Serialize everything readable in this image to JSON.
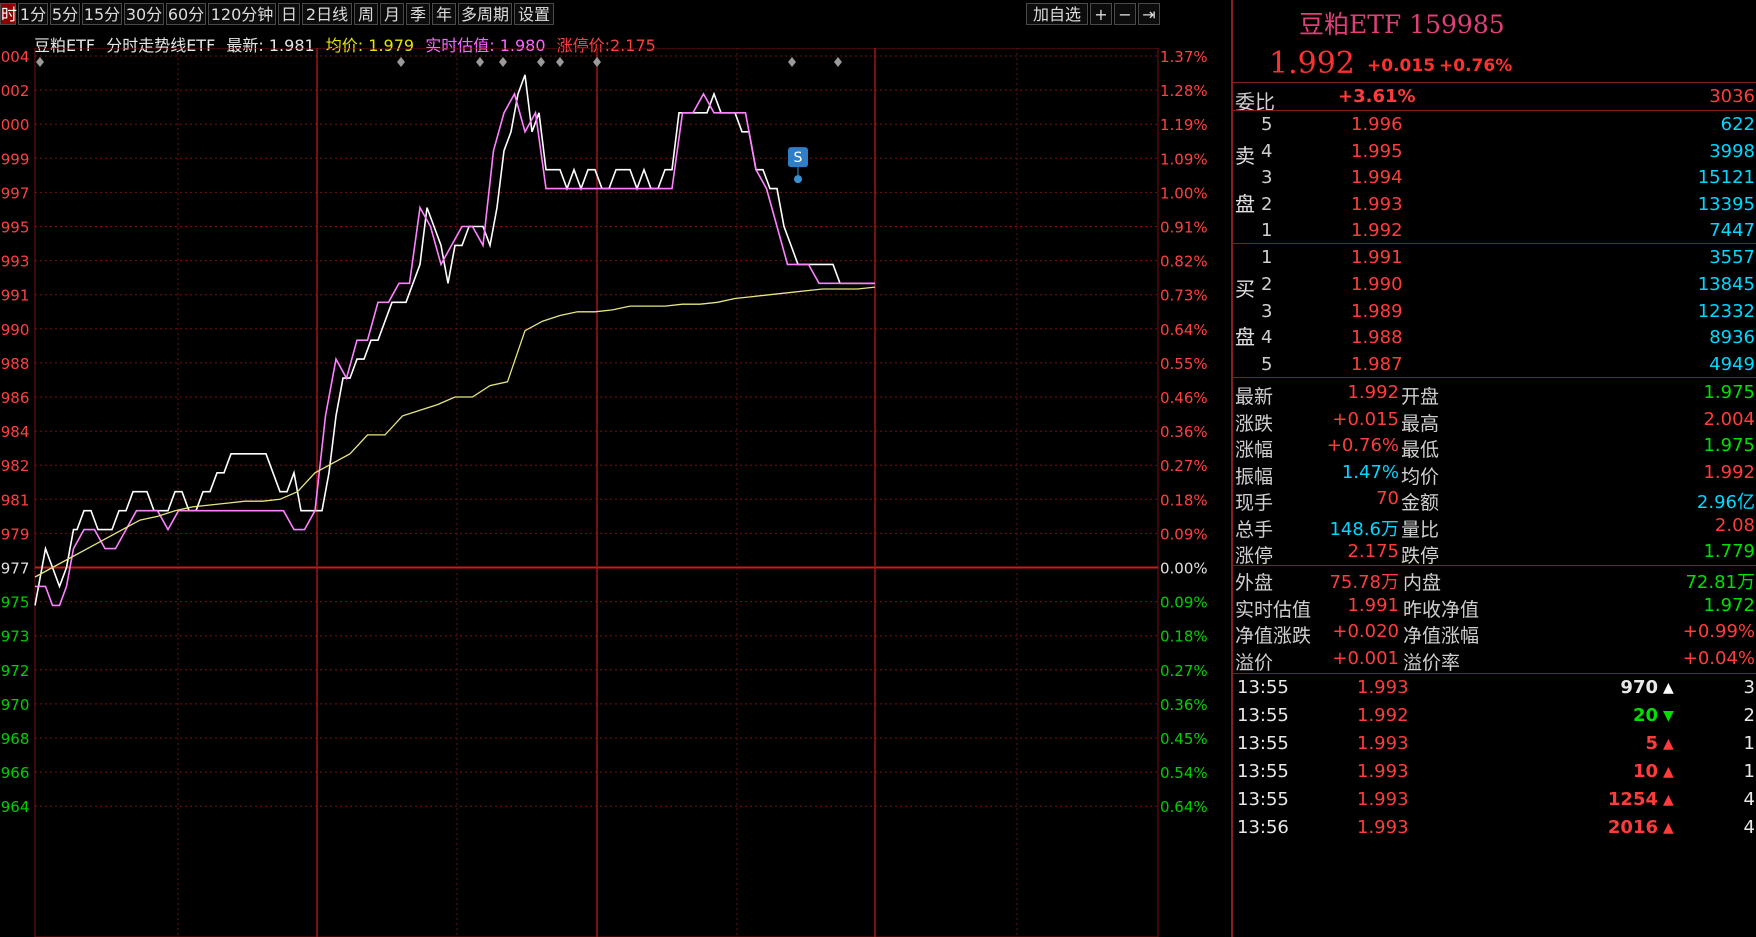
{
  "toolbar": {
    "items": [
      "时",
      "1分",
      "5分",
      "15分",
      "30分",
      "60分",
      "120分钟",
      "日",
      "2日线",
      "周",
      "月",
      "季",
      "年",
      "多周期",
      "设置"
    ],
    "right": {
      "add": "加自选",
      "plus": "+",
      "minus": "−",
      "exit": "⇥"
    }
  },
  "info": {
    "name": "豆粕ETF",
    "indicator": "分时走势线ETF",
    "latest_label": "最新:",
    "latest": "1.981",
    "avg_label": "均价:",
    "avg": "1.979",
    "est_label": "实时估值:",
    "est": "1.980",
    "limit_label": "涨停价:",
    "limit": "2.175"
  },
  "chart_data": {
    "type": "line",
    "title": "豆粕ETF 分时走势线ETF",
    "prev_close": 1.977,
    "y_ticks": [
      ".004",
      ".002",
      ".000",
      ".999",
      ".997",
      ".995",
      ".993",
      ".991",
      ".990",
      ".988",
      ".986",
      ".984",
      ".982",
      ".981",
      ".979",
      ".977",
      ".975",
      ".973",
      ".972",
      ".970",
      ".968",
      ".966",
      ".964"
    ],
    "pct_ticks": [
      "1.37%",
      "1.28%",
      "1.19%",
      "1.09%",
      "1.00%",
      "0.91%",
      "0.82%",
      "0.73%",
      "0.64%",
      "0.55%",
      "0.46%",
      "0.36%",
      "0.27%",
      "0.18%",
      "0.09%",
      "0.00%",
      "0.09%",
      "0.18%",
      "0.27%",
      "0.36%",
      "0.45%",
      "0.54%",
      "0.64%"
    ],
    "ylim": [
      1.9635,
      2.004
    ],
    "series": [
      {
        "name": "最新",
        "color": "#ffffff",
        "x": [
          0,
          3,
          5,
          7,
          9,
          11,
          12,
          14,
          16,
          18,
          20,
          22,
          24,
          26,
          28,
          30,
          32,
          34,
          36,
          38,
          40,
          42,
          44,
          46,
          48,
          50,
          52,
          54,
          56,
          58,
          60,
          62,
          64,
          66,
          68,
          70,
          72,
          74,
          76,
          78,
          80,
          82,
          84,
          86,
          88,
          90,
          92,
          94,
          96,
          98,
          100,
          102,
          104,
          106,
          108,
          110,
          112,
          114,
          116,
          118,
          120,
          122,
          124,
          126,
          128,
          130,
          132,
          134,
          136,
          138,
          140,
          142,
          144,
          146,
          148,
          150,
          152,
          154,
          156,
          158,
          160,
          162,
          164,
          166,
          168,
          170,
          172,
          174,
          176,
          178,
          180,
          182,
          184,
          186,
          188,
          190,
          192,
          194,
          196,
          198,
          200,
          202,
          204,
          206,
          208,
          210,
          212,
          214,
          216,
          218,
          220,
          222,
          224,
          226,
          228,
          230,
          232,
          234,
          236,
          238,
          240
        ],
        "y": [
          1.975,
          1.978,
          1.977,
          1.976,
          1.977,
          1.979,
          1.979,
          1.98,
          1.98,
          1.979,
          1.979,
          1.979,
          1.98,
          1.98,
          1.981,
          1.981,
          1.981,
          1.98,
          1.98,
          1.98,
          1.981,
          1.981,
          1.98,
          1.98,
          1.981,
          1.981,
          1.982,
          1.982,
          1.983,
          1.983,
          1.983,
          1.983,
          1.983,
          1.983,
          1.982,
          1.981,
          1.981,
          1.982,
          1.98,
          1.98,
          1.98,
          1.98,
          1.982,
          1.985,
          1.987,
          1.987,
          1.988,
          1.988,
          1.989,
          1.989,
          1.99,
          1.991,
          1.991,
          1.991,
          1.992,
          1.993,
          1.996,
          1.995,
          1.994,
          1.992,
          1.994,
          1.994,
          1.995,
          1.995,
          1.995,
          1.994,
          1.996,
          1.999,
          2.0,
          2.002,
          2.003,
          2.0,
          2.001,
          1.998,
          1.998,
          1.998,
          1.997,
          1.998,
          1.997,
          1.998,
          1.998,
          1.997,
          1.997,
          1.998,
          1.998,
          1.998,
          1.997,
          1.998,
          1.997,
          1.997,
          1.998,
          1.998,
          2.001,
          2.001,
          2.001,
          2.001,
          2.001,
          2.002,
          2.001,
          2.001,
          2.001,
          2.0,
          2.0,
          1.998,
          1.998,
          1.997,
          1.997,
          1.995,
          1.994,
          1.993,
          1.993,
          1.993,
          1.993,
          1.993,
          1.993,
          1.992,
          1.992,
          1.992,
          1.992,
          1.992,
          1.992
        ]
      },
      {
        "name": "实时估值",
        "color": "#ff80ff",
        "x": [
          0,
          3,
          5,
          7,
          9,
          11,
          14,
          17,
          20,
          23,
          26,
          29,
          32,
          35,
          38,
          41,
          44,
          47,
          50,
          53,
          56,
          59,
          62,
          65,
          68,
          71,
          74,
          77,
          80,
          83,
          86,
          89,
          92,
          95,
          98,
          101,
          104,
          107,
          110,
          113,
          116,
          119,
          122,
          125,
          128,
          131,
          134,
          137,
          140,
          143,
          146,
          149,
          152,
          155,
          158,
          161,
          164,
          167,
          170,
          173,
          176,
          179,
          182,
          185,
          188,
          191,
          194,
          197,
          200,
          203,
          206,
          209,
          212,
          215,
          218,
          221,
          224,
          227,
          230,
          233,
          236,
          239,
          240
        ],
        "y": [
          1.976,
          1.976,
          1.975,
          1.975,
          1.976,
          1.978,
          1.979,
          1.979,
          1.978,
          1.978,
          1.979,
          1.98,
          1.98,
          1.98,
          1.979,
          1.98,
          1.98,
          1.98,
          1.98,
          1.98,
          1.98,
          1.98,
          1.98,
          1.98,
          1.98,
          1.98,
          1.979,
          1.979,
          1.98,
          1.985,
          1.988,
          1.987,
          1.989,
          1.989,
          1.991,
          1.991,
          1.992,
          1.992,
          1.996,
          1.995,
          1.993,
          1.994,
          1.995,
          1.995,
          1.994,
          1.999,
          2.001,
          2.002,
          2.0,
          2.001,
          1.997,
          1.997,
          1.997,
          1.997,
          1.997,
          1.997,
          1.997,
          1.997,
          1.997,
          1.997,
          1.997,
          1.997,
          1.997,
          2.001,
          2.001,
          2.002,
          2.001,
          2.001,
          2.001,
          2.001,
          1.998,
          1.997,
          1.995,
          1.993,
          1.993,
          1.993,
          1.992,
          1.992,
          1.992,
          1.992,
          1.992,
          1.992,
          1.992
        ]
      },
      {
        "name": "均价",
        "color": "#e6e680",
        "x": [
          0,
          5,
          10,
          15,
          20,
          25,
          30,
          35,
          40,
          45,
          50,
          55,
          60,
          65,
          70,
          75,
          80,
          85,
          90,
          95,
          100,
          105,
          110,
          115,
          120,
          125,
          130,
          135,
          140,
          145,
          150,
          155,
          160,
          165,
          170,
          175,
          180,
          185,
          190,
          195,
          200,
          205,
          210,
          215,
          220,
          225,
          230,
          235,
          240
        ],
        "y": [
          1.9765,
          1.977,
          1.9775,
          1.978,
          1.9785,
          1.979,
          1.9795,
          1.9797,
          1.98,
          1.9802,
          1.9803,
          1.9804,
          1.9805,
          1.9805,
          1.9806,
          1.981,
          1.982,
          1.9825,
          1.983,
          1.984,
          1.984,
          1.985,
          1.9853,
          1.9856,
          1.986,
          1.986,
          1.9866,
          1.9868,
          1.9895,
          1.99,
          1.9903,
          1.9905,
          1.9905,
          1.9906,
          1.9908,
          1.9908,
          1.9908,
          1.9909,
          1.9909,
          1.991,
          1.9912,
          1.9913,
          1.9914,
          1.9915,
          1.9916,
          1.9917,
          1.9917,
          1.9917,
          1.9918
        ]
      }
    ],
    "marker_label": "S"
  },
  "panel": {
    "title": "豆粕ETF 159985",
    "price": "1.992",
    "change": "+0.015",
    "change_pct": "+0.76%",
    "weibi": {
      "label": "委比",
      "pct": "+3.61%",
      "diff": "3036"
    },
    "sell_label": [
      "卖",
      "盘"
    ],
    "buy_label": [
      "买",
      "盘"
    ],
    "sells": [
      {
        "lvl": "5",
        "price": "1.996",
        "vol": "622"
      },
      {
        "lvl": "4",
        "price": "1.995",
        "vol": "3998"
      },
      {
        "lvl": "3",
        "price": "1.994",
        "vol": "15121"
      },
      {
        "lvl": "2",
        "price": "1.993",
        "vol": "13395"
      },
      {
        "lvl": "1",
        "price": "1.992",
        "vol": "7447"
      }
    ],
    "buys": [
      {
        "lvl": "1",
        "price": "1.991",
        "vol": "3557"
      },
      {
        "lvl": "2",
        "price": "1.990",
        "vol": "13845"
      },
      {
        "lvl": "3",
        "price": "1.989",
        "vol": "12332"
      },
      {
        "lvl": "4",
        "price": "1.988",
        "vol": "8936"
      },
      {
        "lvl": "5",
        "price": "1.987",
        "vol": "4949"
      }
    ],
    "stats": [
      {
        "l1": "最新",
        "v1": "1.992",
        "c1": "red",
        "l2": "开盘",
        "v2": "1.975",
        "c2": "green"
      },
      {
        "l1": "涨跌",
        "v1": "+0.015",
        "c1": "red",
        "l2": "最高",
        "v2": "2.004",
        "c2": "red"
      },
      {
        "l1": "涨幅",
        "v1": "+0.76%",
        "c1": "red",
        "l2": "最低",
        "v2": "1.975",
        "c2": "green"
      },
      {
        "l1": "振幅",
        "v1": "1.47%",
        "c1": "cyan",
        "l2": "均价",
        "v2": "1.992",
        "c2": "red"
      },
      {
        "l1": "现手",
        "v1": "70",
        "c1": "red",
        "l2": "金额",
        "v2": "2.96亿",
        "c2": "cyan"
      },
      {
        "l1": "总手",
        "v1": "148.6万",
        "c1": "cyan",
        "l2": "量比",
        "v2": "2.08",
        "c2": "red"
      },
      {
        "l1": "涨停",
        "v1": "2.175",
        "c1": "red",
        "l2": "跌停",
        "v2": "1.779",
        "c2": "green"
      }
    ],
    "stats2": [
      {
        "l1": "外盘",
        "v1": "75.78万",
        "c1": "red",
        "l2": "内盘",
        "v2": "72.81万",
        "c2": "green"
      },
      {
        "l1": "实时估值",
        "v1": "1.991",
        "c1": "red",
        "l2": "昨收净值",
        "v2": "1.972",
        "c2": "green"
      },
      {
        "l1": "净值涨跌",
        "v1": "+0.020",
        "c1": "red",
        "l2": "净值涨幅",
        "v2": "+0.99%",
        "c2": "red"
      },
      {
        "l1": "溢价",
        "v1": "+0.001",
        "c1": "red",
        "l2": "溢价率",
        "v2": "+0.04%",
        "c2": "red"
      }
    ],
    "ticks": [
      {
        "time": "13:55",
        "price": "1.993",
        "vol": "970",
        "dir": "up",
        "vc": "white",
        "n": "3"
      },
      {
        "time": "13:55",
        "price": "1.992",
        "vol": "20",
        "dir": "down",
        "vc": "green",
        "n": "2"
      },
      {
        "time": "13:55",
        "price": "1.993",
        "vol": "5",
        "dir": "up",
        "vc": "red",
        "n": "1"
      },
      {
        "time": "13:55",
        "price": "1.993",
        "vol": "10",
        "dir": "up",
        "vc": "red",
        "n": "1"
      },
      {
        "time": "13:55",
        "price": "1.993",
        "vol": "1254",
        "dir": "up",
        "vc": "red",
        "n": "4"
      },
      {
        "time": "13:56",
        "price": "1.993",
        "vol": "2016",
        "dir": "up",
        "vc": "red",
        "n": "4"
      }
    ]
  }
}
